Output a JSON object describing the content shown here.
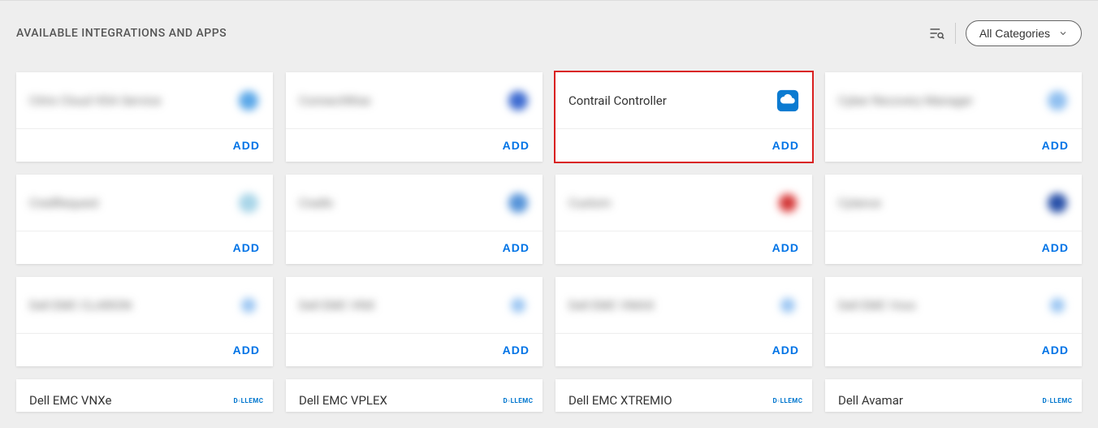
{
  "header": {
    "section_title": "AVAILABLE INTEGRATIONS AND APPS",
    "category_label": "All Categories"
  },
  "add_label": "ADD",
  "cards": [
    {
      "name": "Citrix Cloud VDA Service",
      "blurred": true,
      "icon": "b1",
      "highlight": false
    },
    {
      "name": "ConnectWise",
      "blurred": true,
      "icon": "b2",
      "highlight": false
    },
    {
      "name": "Contrail Controller",
      "blurred": false,
      "icon": "cloud",
      "highlight": true
    },
    {
      "name": "Cyber Recovery Manager",
      "blurred": true,
      "icon": "b3",
      "highlight": false
    },
    {
      "name": "CredRequest",
      "blurred": true,
      "icon": "b4",
      "highlight": false
    },
    {
      "name": "Cradlx",
      "blurred": true,
      "icon": "b5",
      "highlight": false
    },
    {
      "name": "Custom",
      "blurred": true,
      "icon": "b6",
      "highlight": false
    },
    {
      "name": "Cylance",
      "blurred": true,
      "icon": "b7",
      "highlight": false
    },
    {
      "name": "Dell EMC CLARION",
      "blurred": true,
      "icon": "b8",
      "highlight": false
    },
    {
      "name": "Dell EMC VNX",
      "blurred": true,
      "icon": "b9",
      "highlight": false
    },
    {
      "name": "Dell EMC VMAX",
      "blurred": true,
      "icon": "b10",
      "highlight": false
    },
    {
      "name": "Dell EMC Vxxx",
      "blurred": true,
      "icon": "b11",
      "highlight": false
    }
  ],
  "partial_cards": [
    {
      "name": "Dell EMC VNXe"
    },
    {
      "name": "Dell EMC VPLEX"
    },
    {
      "name": "Dell EMC XTREMIO"
    },
    {
      "name": "Dell Avamar"
    }
  ]
}
